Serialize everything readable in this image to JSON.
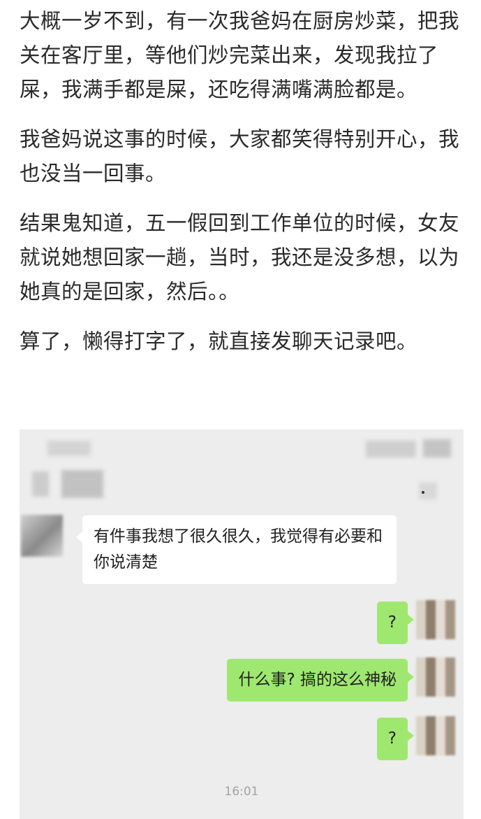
{
  "article": {
    "paragraphs": [
      "大概一岁不到，有一次我爸妈在厨房炒菜，把我关在客厅里，等他们炒完菜出来，发现我拉了屎，我满手都是屎，还吃得满嘴满脸都是。",
      "我爸妈说这事的时候，大家都笑得特别开心，我也没当一回事。",
      "结果鬼知道，五一假回到工作单位的时候，女友就说她想回家一趟，当时，我还是没多想，以为她真的是回家，然后。。",
      "算了，懒得打字了，就直接发聊天记录吧。"
    ]
  },
  "chat": {
    "messages": [
      {
        "sender": "girlfriend",
        "text": "有件事我想了很久很久，我觉得有必要和你说清楚"
      },
      {
        "sender": "me",
        "text": "?"
      },
      {
        "sender": "me",
        "text": "什么事? 搞的这么神秘"
      },
      {
        "sender": "me",
        "text": "?"
      }
    ],
    "timestamp": "16:01"
  },
  "colors": {
    "chat_background": "#ededed",
    "incoming_bubble": "#ffffff",
    "outgoing_bubble": "#9fe870"
  }
}
